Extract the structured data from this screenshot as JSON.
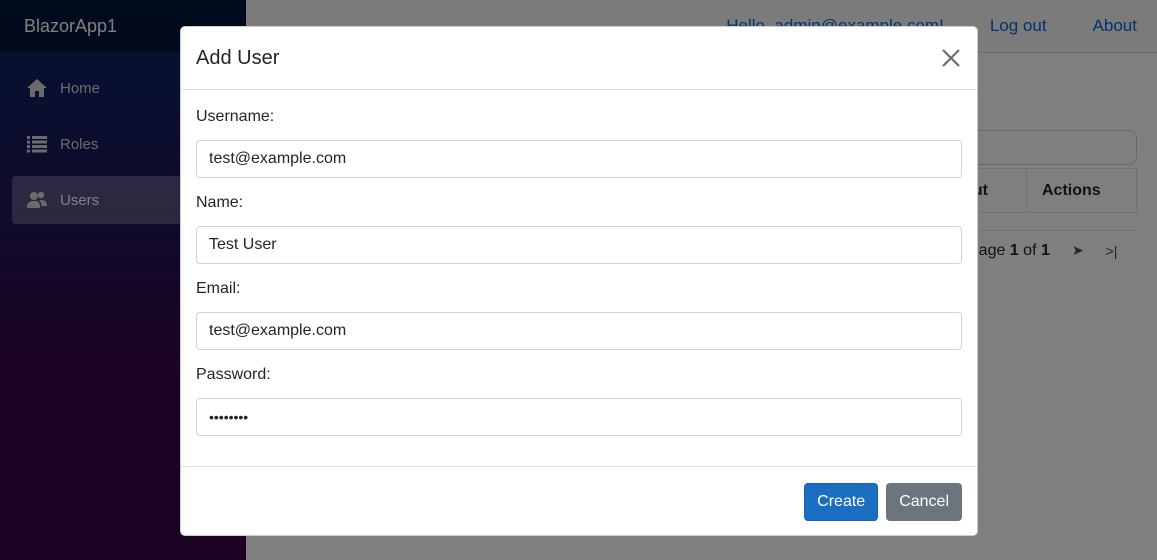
{
  "app": {
    "brand": "BlazorApp1"
  },
  "sidebar": {
    "items": [
      {
        "label": "Home",
        "icon": "home-icon",
        "active": false
      },
      {
        "label": "Roles",
        "icon": "list-icon",
        "active": false
      },
      {
        "label": "Users",
        "icon": "people-icon",
        "active": true
      }
    ]
  },
  "top_row": {
    "greeting": "Hello, admin@example.com!",
    "logout": "Log out",
    "about": "About"
  },
  "background_grid": {
    "columns": [
      "Lockout",
      "Actions"
    ],
    "visible_column_fragment": "ut",
    "pager": {
      "prefix": "Page ",
      "current": "1",
      "separator": " of ",
      "total": "1",
      "next_icon": "next-page-icon",
      "last_icon": "last-page-icon"
    }
  },
  "modal": {
    "title": "Add User",
    "close_icon": "close-icon",
    "fields": [
      {
        "label": "Username:",
        "value": "test@example.com",
        "type": "text"
      },
      {
        "label": "Name:",
        "value": "Test User",
        "type": "text"
      },
      {
        "label": "Email:",
        "value": "test@example.com",
        "type": "email"
      },
      {
        "label": "Password:",
        "value": "••••••••",
        "type": "password"
      }
    ],
    "buttons": {
      "create": "Create",
      "cancel": "Cancel"
    }
  },
  "colors": {
    "primary": "#1b6ec2",
    "secondary": "#6c757d",
    "link": "#0366d6",
    "sidebar_top": "#052767",
    "sidebar_bottom": "#3a0647"
  }
}
